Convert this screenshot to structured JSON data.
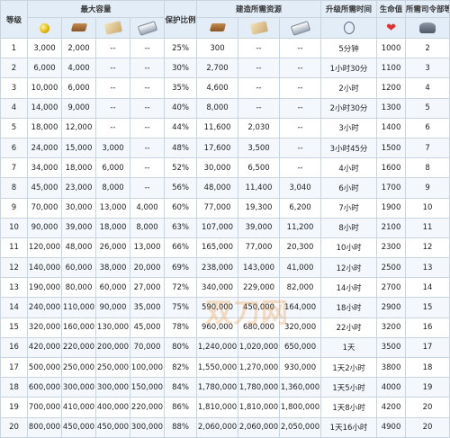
{
  "headers": {
    "level": "等级",
    "max_capacity": "最大容量",
    "protect_ratio": "保护比例",
    "build_resources": "建造所需资源",
    "upgrade_time": "升级所需时间",
    "hp": "生命值",
    "hq_level": "所需司令部等级"
  },
  "icons": {
    "cap_gold": "gold-coin-icon",
    "cap_wood": "wood-icon",
    "cap_stone": "stone-icon",
    "cap_iron": "iron-icon",
    "build_wood": "wood-icon",
    "build_stone": "stone-icon",
    "build_iron": "iron-icon",
    "time": "stopwatch-icon",
    "hp": "heart-icon",
    "hq": "headquarters-icon"
  },
  "rows": [
    [
      "1",
      "3,000",
      "2,000",
      "--",
      "--",
      "25%",
      "300",
      "--",
      "--",
      "5分钟",
      "1000",
      "2"
    ],
    [
      "2",
      "6,000",
      "4,000",
      "--",
      "--",
      "30%",
      "2,700",
      "--",
      "--",
      "1小时30分",
      "1100",
      "3"
    ],
    [
      "3",
      "10,000",
      "6,000",
      "--",
      "--",
      "35%",
      "4,600",
      "--",
      "--",
      "2小时",
      "1200",
      "4"
    ],
    [
      "4",
      "14,000",
      "9,000",
      "--",
      "--",
      "40%",
      "8,000",
      "--",
      "--",
      "2小时30分",
      "1300",
      "5"
    ],
    [
      "5",
      "18,000",
      "12,000",
      "--",
      "--",
      "44%",
      "11,600",
      "2,030",
      "--",
      "3小时",
      "1400",
      "6"
    ],
    [
      "6",
      "24,000",
      "15,000",
      "3,000",
      "--",
      "48%",
      "17,600",
      "3,500",
      "--",
      "3小时45分",
      "1500",
      "7"
    ],
    [
      "7",
      "34,000",
      "18,000",
      "6,000",
      "--",
      "52%",
      "30,000",
      "6,500",
      "--",
      "4小时",
      "1600",
      "8"
    ],
    [
      "8",
      "45,000",
      "23,000",
      "8,000",
      "--",
      "56%",
      "48,000",
      "11,400",
      "3,040",
      "6小时",
      "1700",
      "9"
    ],
    [
      "9",
      "70,000",
      "30,000",
      "13,000",
      "4,000",
      "60%",
      "77,000",
      "19,300",
      "6,200",
      "7小时",
      "1900",
      "10"
    ],
    [
      "10",
      "90,000",
      "39,000",
      "18,000",
      "8,000",
      "63%",
      "107,000",
      "39,000",
      "11,200",
      "8小时",
      "2100",
      "11"
    ],
    [
      "11",
      "120,000",
      "48,000",
      "26,000",
      "13,000",
      "66%",
      "165,000",
      "77,000",
      "20,300",
      "10小时",
      "2300",
      "12"
    ],
    [
      "12",
      "140,000",
      "60,000",
      "38,000",
      "20,000",
      "69%",
      "238,000",
      "143,000",
      "41,000",
      "12小时",
      "2500",
      "13"
    ],
    [
      "13",
      "190,000",
      "80,000",
      "60,000",
      "27,000",
      "72%",
      "340,000",
      "229,000",
      "82,000",
      "14小时",
      "2700",
      "14"
    ],
    [
      "14",
      "240,000",
      "110,000",
      "90,000",
      "35,000",
      "75%",
      "590,000",
      "450,000",
      "164,000",
      "18小时",
      "2900",
      "15"
    ],
    [
      "15",
      "320,000",
      "160,000",
      "130,000",
      "45,000",
      "78%",
      "960,000",
      "680,000",
      "320,000",
      "22小时",
      "3200",
      "16"
    ],
    [
      "16",
      "420,000",
      "220,000",
      "200,000",
      "70,000",
      "80%",
      "1,240,000",
      "1,020,000",
      "650,000",
      "1天",
      "3500",
      "17"
    ],
    [
      "17",
      "500,000",
      "250,000",
      "250,000",
      "100,000",
      "82%",
      "1,550,000",
      "1,270,000",
      "930,000",
      "1天2小时",
      "3800",
      "18"
    ],
    [
      "18",
      "600,000",
      "300,000",
      "300,000",
      "150,000",
      "84%",
      "1,780,000",
      "1,780,000",
      "1,360,000",
      "1天5小时",
      "4000",
      "19"
    ],
    [
      "19",
      "700,000",
      "410,000",
      "400,000",
      "220,000",
      "86%",
      "1,810,000",
      "1,810,000",
      "1,800,000",
      "1天8小时",
      "4200",
      "20"
    ],
    [
      "20",
      "800,000",
      "450,000",
      "450,000",
      "300,000",
      "88%",
      "2,060,000",
      "2,060,000",
      "2,050,000",
      "1天16小时",
      "4900",
      "20"
    ]
  ],
  "watermark": "双刀网"
}
